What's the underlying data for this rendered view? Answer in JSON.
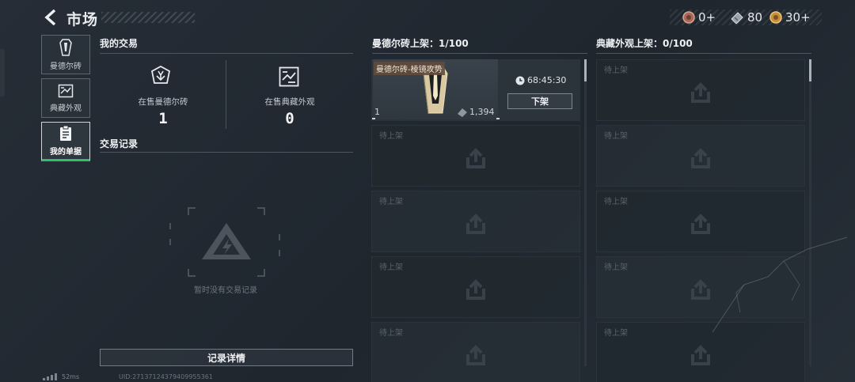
{
  "header": {
    "title": "市场",
    "currencies": [
      {
        "icon": "medal-coin-icon",
        "value": "0+"
      },
      {
        "icon": "ticket-icon",
        "value": "80"
      },
      {
        "icon": "gold-coin-icon",
        "value": "30+"
      }
    ]
  },
  "tabs": [
    {
      "label": "曼德尔砖",
      "icon": "mandel-brick-icon"
    },
    {
      "label": "典藏外观",
      "icon": "collection-skin-icon"
    },
    {
      "label": "我的单据",
      "icon": "clipboard-icon",
      "active": true
    }
  ],
  "my_trades": {
    "heading": "我的交易",
    "stats": [
      {
        "label": "在售曼德尔砖",
        "value": "1",
        "icon": "brick-badge-icon"
      },
      {
        "label": "在售典藏外观",
        "value": "0",
        "icon": "skin-badge-icon"
      }
    ]
  },
  "trade_records": {
    "heading": "交易记录",
    "empty_text": "暂时没有交易记录",
    "details_button": "记录详情"
  },
  "brick_listings": {
    "heading": "曼德尔砖上架：1/100",
    "item": {
      "name": "曼德尔砖-棱镜攻势",
      "quantity": "1",
      "price": "1,394",
      "timer": "68:45:30",
      "delist_label": "下架"
    },
    "empty_label": "待上架",
    "empty_count": 4
  },
  "skin_listings": {
    "heading": "典藏外观上架：0/100",
    "empty_label": "待上架",
    "empty_count": 5
  },
  "footer": {
    "ping": "52ms",
    "uid": "UID:271371243794099553​61"
  },
  "colors": {
    "accent_green": "#2fc06a",
    "background": "#232a32"
  }
}
